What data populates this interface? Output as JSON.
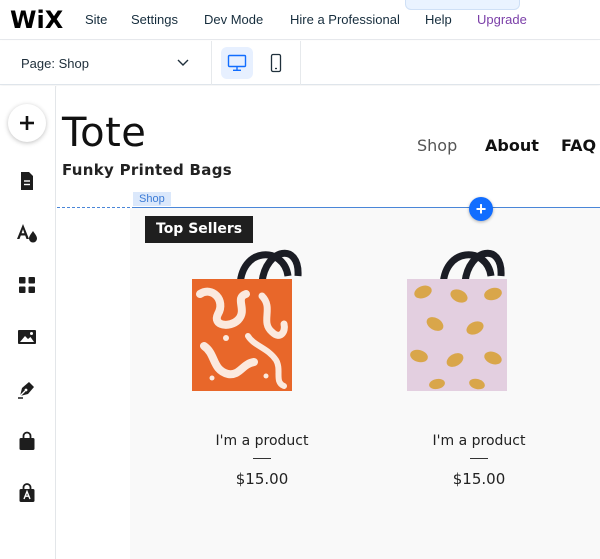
{
  "topbar": {
    "logo": "WiX",
    "menu": [
      "Site",
      "Settings",
      "Dev Mode",
      "Hire a Professional",
      "Help",
      "Upgrade"
    ],
    "accent_upgrade": "#7b3fa8"
  },
  "pagebar": {
    "page_label": "Page: Shop",
    "devices": [
      "desktop-icon",
      "mobile-icon"
    ],
    "active_device": "desktop-icon"
  },
  "sidebar": {
    "tools": [
      "add-icon",
      "pages-icon",
      "theme-icon",
      "apps-icon",
      "media-icon",
      "blog-icon",
      "store-icon",
      "bookings-icon"
    ]
  },
  "site": {
    "title": "Tote",
    "tagline": "Funky Printed Bags",
    "nav": [
      "Shop",
      "About",
      "FAQ"
    ],
    "active_nav": "Shop"
  },
  "editor": {
    "section_label": "Shop",
    "accent": "#116dff"
  },
  "shop": {
    "heading": "Top Sellers",
    "products": [
      {
        "name": "I'm a product",
        "price": "$15.00",
        "pattern": "orange-abstract"
      },
      {
        "name": "I'm a product",
        "price": "$15.00",
        "pattern": "lemons-on-lilac"
      }
    ]
  }
}
